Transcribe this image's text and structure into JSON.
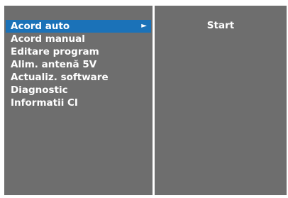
{
  "menu": {
    "items": [
      {
        "label": "Acord auto",
        "selected": true,
        "arrow": "►"
      },
      {
        "label": "Acord manual"
      },
      {
        "label": "Editare program"
      },
      {
        "label": "Alim. antenă 5V"
      },
      {
        "label": "Actualiz. software"
      },
      {
        "label": "Diagnostic"
      },
      {
        "label": "Informatii CI"
      }
    ]
  },
  "submenu": {
    "label": "Start"
  },
  "colors": {
    "panel_background": "#6e6e6e",
    "selection_highlight": "#1b72b8",
    "text": "#ffffff",
    "screen_background": "#ffffff"
  },
  "icons": {
    "submenu_arrow": "right-triangle-icon"
  }
}
